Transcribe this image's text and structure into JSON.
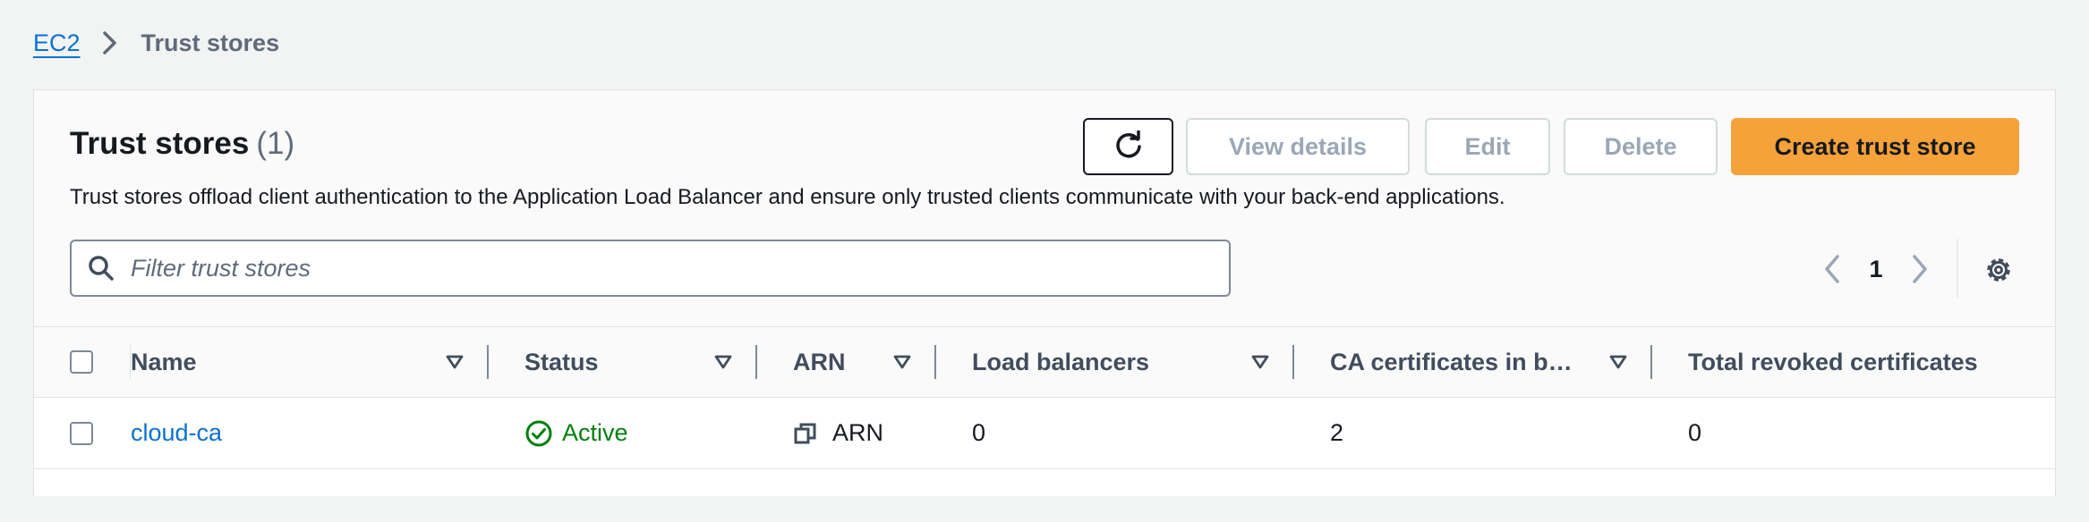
{
  "breadcrumb": {
    "root": "EC2",
    "current": "Trust stores"
  },
  "header": {
    "title": "Trust stores",
    "count": "(1)",
    "description": "Trust stores offload client authentication to the Application Load Balancer and ensure only trusted clients communicate with your back-end applications."
  },
  "actions": {
    "refresh_icon": "refresh-icon",
    "view_details": "View details",
    "edit": "Edit",
    "delete": "Delete",
    "create": "Create trust store"
  },
  "search": {
    "placeholder": "Filter trust stores"
  },
  "pagination": {
    "page": "1"
  },
  "table": {
    "columns": [
      "Name",
      "Status",
      "ARN",
      "Load balancers",
      "CA certificates in b…",
      "Total revoked certificates"
    ],
    "rows": [
      {
        "name": "cloud-ca",
        "status": "Active",
        "arn": "ARN",
        "load_balancers": "0",
        "ca_certificates": "2",
        "revoked": "0"
      }
    ]
  },
  "colors": {
    "link": "#0972d3",
    "primary": "#f5a23a",
    "success": "#037f0c",
    "disabled": "#9ba7b6"
  }
}
